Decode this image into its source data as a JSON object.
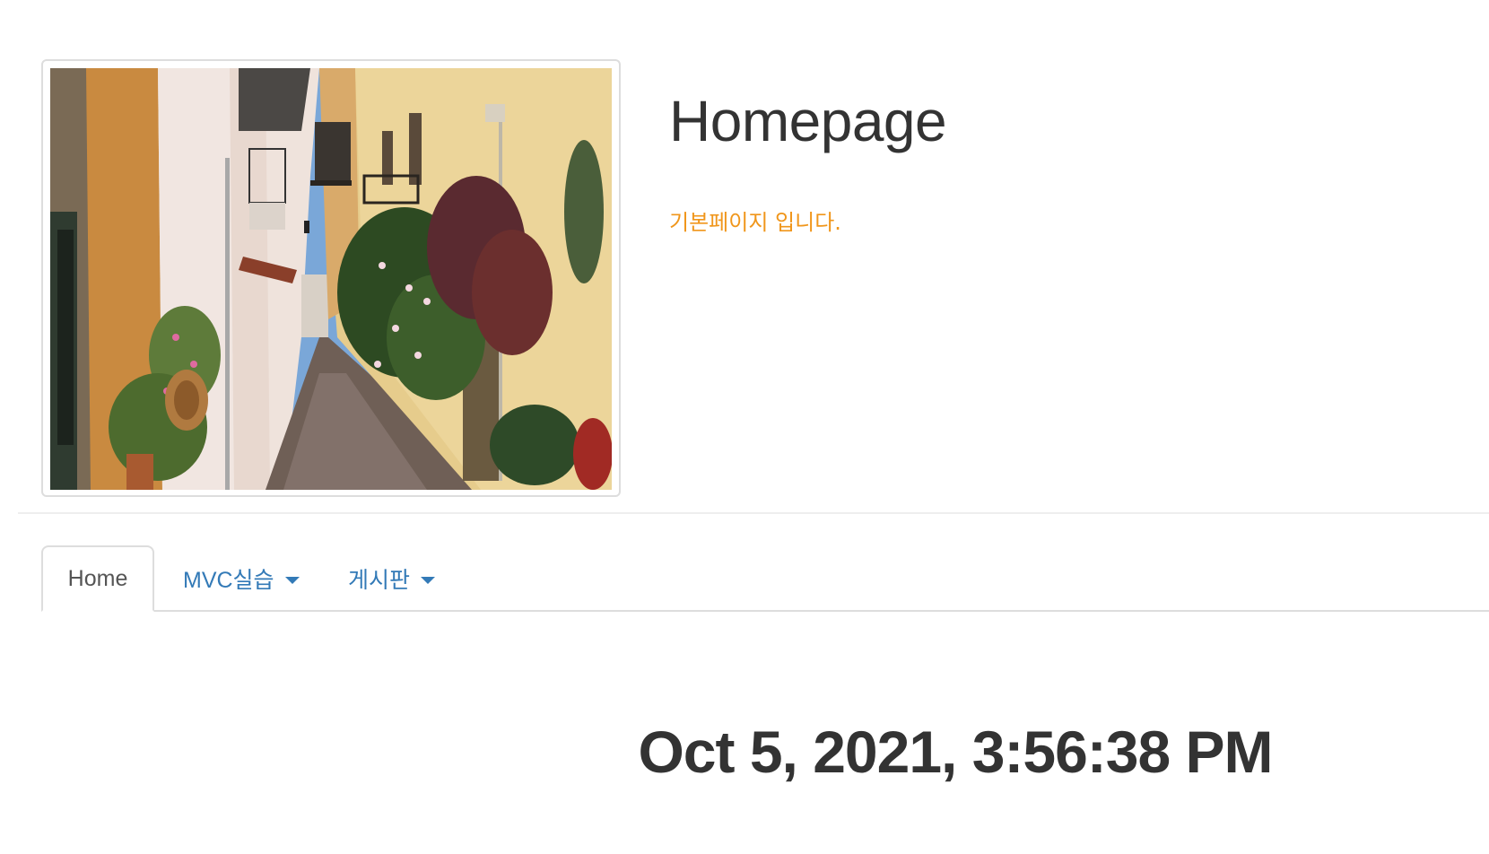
{
  "header": {
    "title": "Homepage",
    "subtitle": "기본페이지 입니다."
  },
  "nav": {
    "tabs": [
      {
        "label": "Home",
        "active": true
      },
      {
        "label": "MVC실습",
        "dropdown": true
      },
      {
        "label": "게시판",
        "dropdown": true
      }
    ]
  },
  "main": {
    "timestamp": "Oct 5, 2021, 3:56:38 PM"
  },
  "colors": {
    "subtitle": "#f0961b",
    "link": "#337ab7",
    "text": "#333333",
    "border": "#dddddd"
  }
}
